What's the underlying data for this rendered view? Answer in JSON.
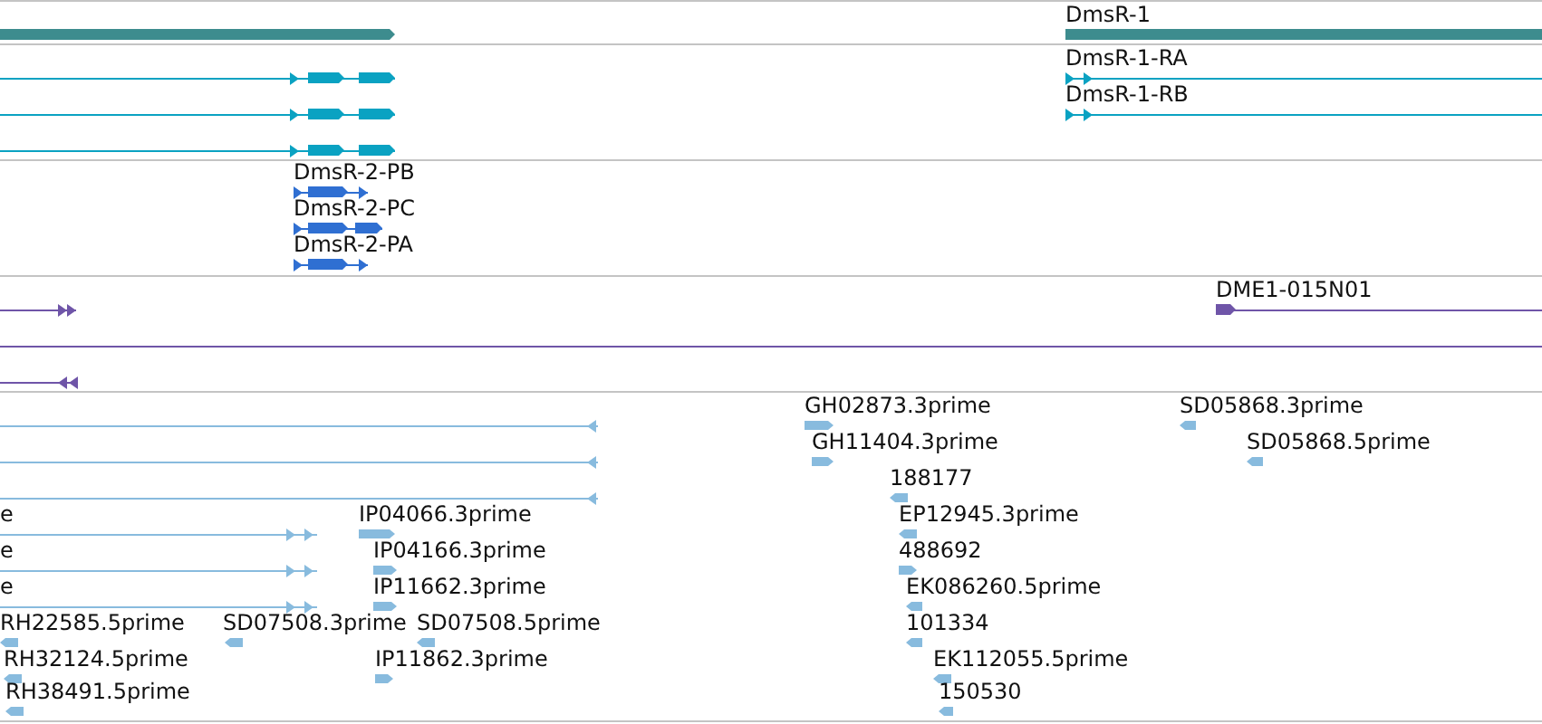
{
  "tracks": [
    {
      "color": "#3d8c8e",
      "features": [
        {
          "kind": "gene",
          "reverse": false
        },
        {
          "kind": "gene",
          "label": "DmsR-1"
        }
      ]
    },
    {
      "color": "#0aa2c2",
      "features": [
        {
          "kind": "transcript",
          "reverse": false
        },
        {
          "kind": "transcript",
          "reverse": false
        },
        {
          "kind": "transcript",
          "reverse": false
        },
        {
          "kind": "transcript",
          "label": "DmsR-1-RA",
          "reverse": false
        },
        {
          "kind": "transcript",
          "label": "DmsR-1-RB",
          "reverse": false
        }
      ]
    },
    {
      "color": "#2f6fd2",
      "features": [
        {
          "kind": "transcript",
          "label": "DmsR-2-PB",
          "reverse": false
        },
        {
          "kind": "transcript",
          "label": "DmsR-2-PC",
          "reverse": false
        },
        {
          "kind": "transcript",
          "label": "DmsR-2-PA",
          "reverse": false
        }
      ]
    },
    {
      "color": "#6f55a8",
      "features": [
        {
          "kind": "transcript",
          "reverse": false
        },
        {
          "kind": "transcript",
          "label": "DME1-015N01",
          "reverse": false
        },
        {
          "kind": "transcript"
        },
        {
          "kind": "transcript",
          "reverse": true
        }
      ]
    },
    {
      "color": "#88bbde",
      "features": [
        {
          "kind": "transcript",
          "reverse": true
        },
        {
          "kind": "read",
          "label": "GH02873.3prime",
          "reverse": false
        },
        {
          "kind": "read",
          "label": "SD05868.3prime",
          "reverse": true
        },
        {
          "kind": "transcript",
          "reverse": true
        },
        {
          "kind": "read",
          "label": "GH11404.3prime",
          "reverse": false
        },
        {
          "kind": "read",
          "label": "SD05868.5prime",
          "reverse": true
        },
        {
          "kind": "transcript",
          "reverse": true
        },
        {
          "kind": "read",
          "label": "188177",
          "reverse": true
        },
        {
          "kind": "transcript",
          "label": "e",
          "reverse": false
        },
        {
          "kind": "read",
          "label": "IP04066.3prime",
          "reverse": false
        },
        {
          "kind": "read",
          "label": "EP12945.3prime",
          "reverse": true
        },
        {
          "kind": "transcript",
          "label": "e",
          "reverse": false
        },
        {
          "kind": "read",
          "label": "IP04166.3prime",
          "reverse": false
        },
        {
          "kind": "read",
          "label": "488692",
          "reverse": false
        },
        {
          "kind": "transcript",
          "label": "e",
          "reverse": false
        },
        {
          "kind": "read",
          "label": "IP11662.3prime",
          "reverse": false
        },
        {
          "kind": "read",
          "label": "EK086260.5prime",
          "reverse": true
        },
        {
          "kind": "read",
          "label": "RH22585.5prime",
          "reverse": true
        },
        {
          "kind": "read",
          "label": "SD07508.3prime",
          "reverse": true
        },
        {
          "kind": "read",
          "label": "SD07508.5prime",
          "reverse": true
        },
        {
          "kind": "read",
          "label": "101334",
          "reverse": true
        },
        {
          "kind": "read",
          "label": "RH32124.5prime",
          "reverse": true
        },
        {
          "kind": "read",
          "label": "IP11862.3prime",
          "reverse": false
        },
        {
          "kind": "read",
          "label": "EK112055.5prime",
          "reverse": true
        },
        {
          "kind": "read",
          "label": "RH38491.5prime",
          "reverse": true
        },
        {
          "kind": "read",
          "label": "150530",
          "reverse": true
        }
      ]
    }
  ]
}
